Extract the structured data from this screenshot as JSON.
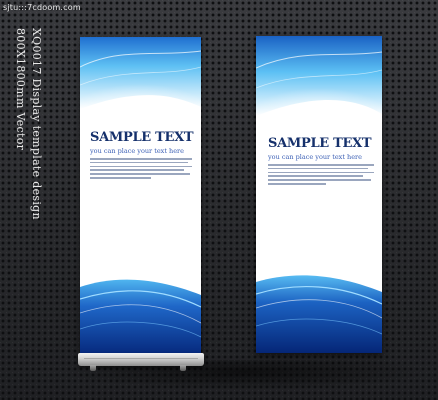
{
  "watermark": "sjtu:::7cdoom.com",
  "side_caption": {
    "line1": "XQ0017 Display template design",
    "line2": "800X1800mm Vector"
  },
  "banners": [
    {
      "title": "SAMPLE TEXT",
      "subtitle": "you can place your text here",
      "body_line_count": 6
    },
    {
      "title": "SAMPLE TEXT",
      "subtitle": "you can place your text here",
      "body_line_count": 6
    }
  ],
  "colors": {
    "background": "#2c2d30",
    "title": "#15306b",
    "subtitle": "#3b5fb5",
    "wave_dark": "#0a3f9e",
    "wave_light": "#58b8f0"
  },
  "icons": [
    "roll-up-stand-icon"
  ]
}
